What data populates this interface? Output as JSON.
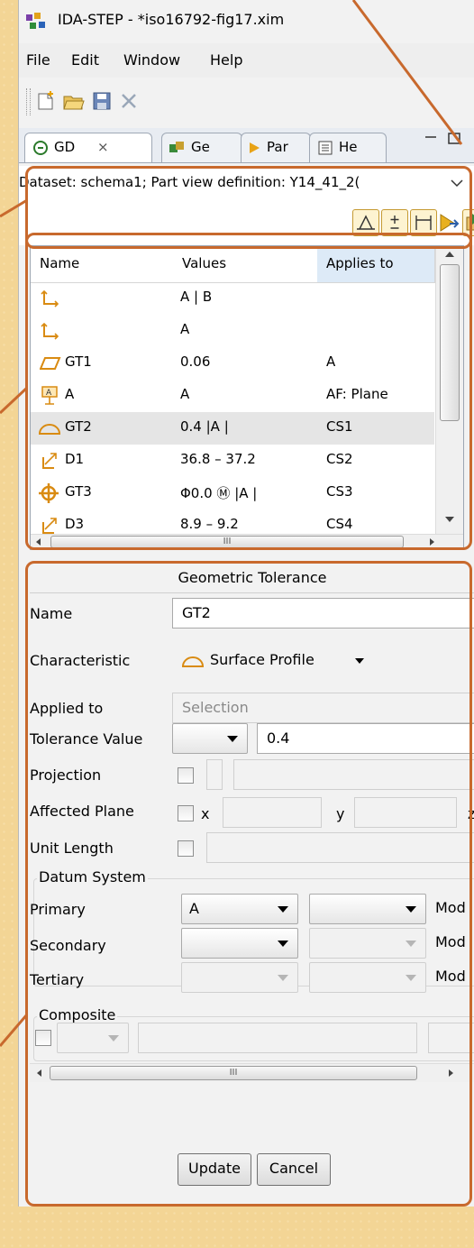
{
  "window": {
    "title": "IDA-STEP - *iso16792-fig17.xim",
    "menu": [
      "File",
      "Edit",
      "Window",
      "Help"
    ]
  },
  "tabs": [
    {
      "label": "GD",
      "close": "⨯"
    },
    {
      "label": "Ge"
    },
    {
      "label": "Par"
    },
    {
      "label": "He"
    }
  ],
  "dataset": {
    "text": "Dataset: schema1; Part view definition: Y14_41_2("
  },
  "table": {
    "headers": [
      "Name",
      "Values",
      "Applies to"
    ],
    "rows": [
      {
        "icon": "datum-system-icon",
        "name": "",
        "values": "A | B",
        "applies": ""
      },
      {
        "icon": "datum-system-icon",
        "name": "",
        "values": "A",
        "applies": ""
      },
      {
        "icon": "flatness-icon",
        "name": "GT1",
        "values": "0.06",
        "applies": "A"
      },
      {
        "icon": "datum-feature-icon",
        "name": "A",
        "values": "A",
        "applies": "AF: Plane"
      },
      {
        "icon": "surface-profile-icon",
        "name": "GT2",
        "values": "0.4  |A |",
        "applies": "CS1"
      },
      {
        "icon": "dimension-icon",
        "name": "D1",
        "values": "36.8 – 37.2",
        "applies": "CS2"
      },
      {
        "icon": "position-icon",
        "name": "GT3",
        "values": "Φ0.0 Ⓜ |A |",
        "applies": "CS3"
      },
      {
        "icon": "dimension-icon",
        "name": "D3",
        "values": "8.9 – 9.2",
        "applies": "CS4"
      }
    ],
    "hscroll_grip": "III"
  },
  "form": {
    "header": "Geometric Tolerance",
    "name_label": "Name",
    "name_value": "GT2",
    "characteristic_label": "Characteristic",
    "characteristic_value": "Surface Profile",
    "applied_label": "Applied to",
    "applied_placeholder": "Selection",
    "tolerance_label": "Tolerance Value",
    "tolerance_value": "0.4",
    "projection_label": "Projection",
    "affected_label": "Affected Plane",
    "affected_x": "x",
    "affected_y": "y",
    "affected_z": "z",
    "unit_label": "Unit Length",
    "datum_group": "Datum System",
    "primary_label": "Primary",
    "primary_value": "A",
    "secondary_label": "Secondary",
    "tertiary_label": "Tertiary",
    "mod_label": "Mod",
    "composite_group": "Composite",
    "hscroll_grip": "III",
    "update_button": "Update",
    "cancel_button": "Cancel"
  },
  "colors": {
    "accent_orange": "#c8692d",
    "background": "#f3d595"
  }
}
